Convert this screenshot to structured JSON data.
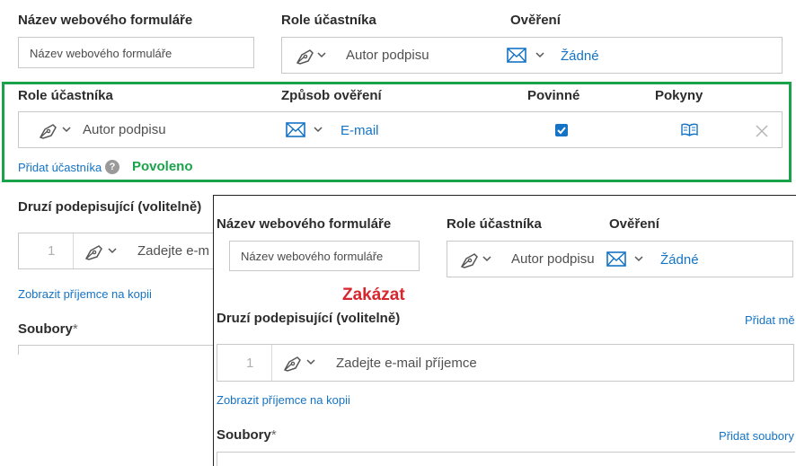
{
  "top": {
    "form_name_label": "Název webového formuláře",
    "form_name_placeholder": "Název webového formuláře",
    "role_label": "Role účastníka",
    "verification_label": "Ověření",
    "role_value": "Autor podpisu",
    "verification_value": "Žádné"
  },
  "highlight": {
    "role_label": "Role účastníka",
    "auth_method_label": "Způsob ověření",
    "required_label": "Povinné",
    "instructions_label": "Pokyny",
    "role_value": "Autor podpisu",
    "auth_value": "E-mail",
    "required_checked": true,
    "add_participant": "Přidat účastníka",
    "status_text": "Povoleno",
    "status_color": "#1aa34a"
  },
  "left": {
    "other_signers_label": "Druzí podepisující (volitelně)",
    "row_number": "1",
    "email_placeholder": "Zadejte e-m",
    "show_recipients": "Zobrazit příjemce na kopii",
    "files_label": "Soubory",
    "required_star": "*"
  },
  "overlay": {
    "form_name_label": "Název webového formuláře",
    "form_name_placeholder": "Název webového formuláře",
    "role_label": "Role účastníka",
    "verification_label": "Ověření",
    "role_value": "Autor podpisu",
    "verification_value": "Žádné",
    "status_text": "Zakázat",
    "status_color": "#d7262e",
    "other_signers_label": "Druzí podepisující (volitelně)",
    "add_me": "Přidat mě",
    "row_number": "1",
    "email_placeholder": "Zadejte e-mail příjemce",
    "show_recipients": "Zobrazit příjemce na kopii",
    "files_label": "Soubory",
    "required_star": "*",
    "add_files": "Přidat soubory"
  },
  "icons": {
    "pen": "pen-nib-icon",
    "mail": "envelope-icon",
    "book": "book-icon",
    "close": "close-icon",
    "help": "help-icon",
    "chevron": "chevron-down-icon"
  },
  "colors": {
    "accent": "#1473c5",
    "border": "#c8c8c8"
  }
}
